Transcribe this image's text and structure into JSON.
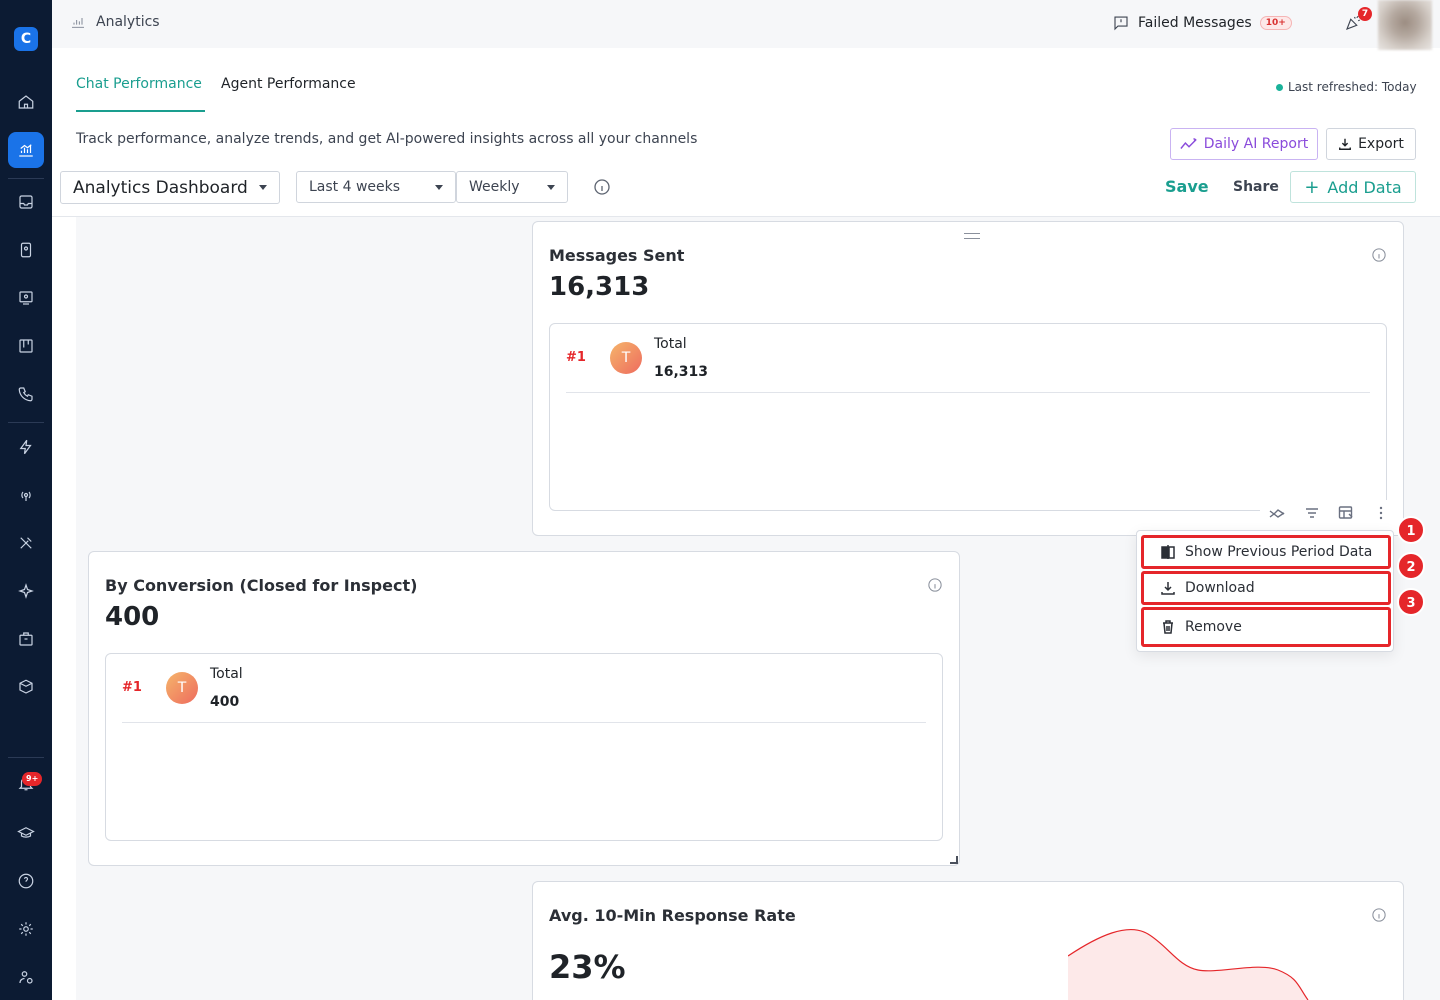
{
  "header": {
    "title": "Analytics",
    "failed_label": "Failed Messages",
    "failed_badge": "10+",
    "party_badge": "7"
  },
  "tabs": [
    {
      "label": "Chat Performance",
      "active": true
    },
    {
      "label": "Agent Performance",
      "active": false
    }
  ],
  "last_refreshed": "Last refreshed: Today",
  "subtitle": "Track performance, analyze trends, and get AI-powered insights across all your channels",
  "buttons": {
    "daily_ai_report": "Daily AI Report",
    "export": "Export",
    "save": "Save",
    "share": "Share",
    "add_data": "Add Data"
  },
  "filters": {
    "dashboard": "Analytics Dashboard",
    "range": "Last 4 weeks",
    "granularity": "Weekly"
  },
  "sidebar": {
    "notification_badge": "9+",
    "logo": "C"
  },
  "cards": [
    {
      "title": "Messages Sent",
      "value": "16,313",
      "rows": [
        {
          "rank": "#1",
          "avatar": "T",
          "label": "Total",
          "value": "16,313"
        }
      ]
    },
    {
      "title": "By Conversion (Closed for Inspect)",
      "value": "400",
      "rows": [
        {
          "rank": "#1",
          "avatar": "T",
          "label": "Total",
          "value": "400"
        }
      ]
    },
    {
      "title": "Avg. 10-Min Response Rate",
      "value": "23%"
    }
  ],
  "context_menu": [
    {
      "label": "Show Previous Period Data",
      "marker": "1",
      "icon": "compare-icon"
    },
    {
      "label": "Download",
      "marker": "2",
      "icon": "download-icon"
    },
    {
      "label": "Remove",
      "marker": "3",
      "icon": "trash-icon"
    }
  ],
  "colors": {
    "accent": "#1a9e8f",
    "sidebar": "#0c1b33",
    "active_nav": "#1a73e8",
    "ai": "#8a4bdb",
    "alert": "#e5262a"
  }
}
